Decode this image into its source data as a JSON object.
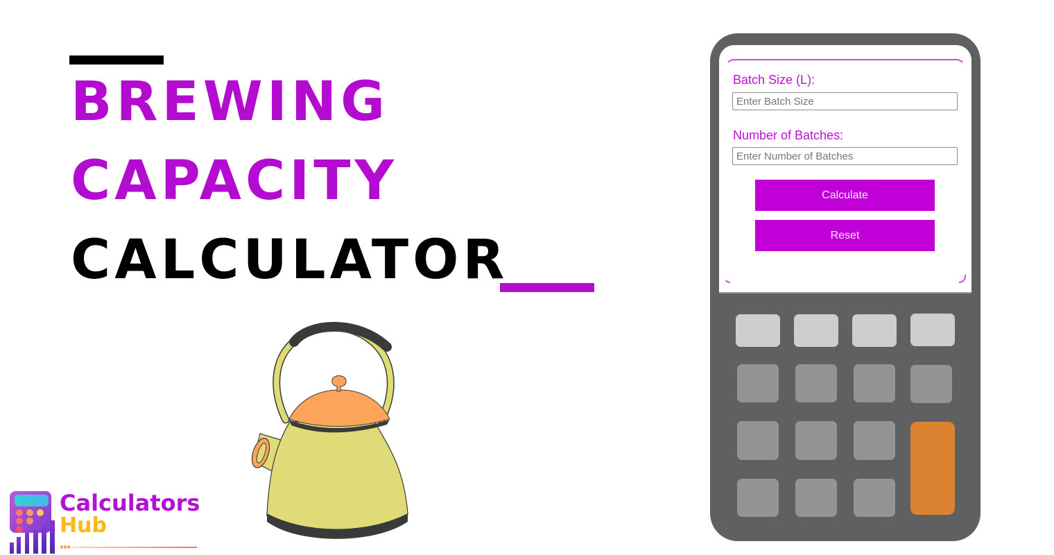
{
  "title": {
    "line1": "Brewing",
    "line2": "Capacity",
    "line3": "Calculator"
  },
  "brand": {
    "name_part1": "Calculators",
    "name_part2": "Hub",
    "primary_color": "#b30bd0",
    "secondary_color": "#fdb813"
  },
  "calculator_form": {
    "fields": [
      {
        "label": "Batch Size (L):",
        "placeholder": "Enter Batch Size",
        "value": ""
      },
      {
        "label": "Number of Batches:",
        "placeholder": "Enter Number of Batches",
        "value": ""
      }
    ],
    "calculate_label": "Calculate",
    "reset_label": "Reset",
    "accent_color": "#c000d6"
  },
  "keypad": {
    "colors": {
      "top_row": "#cfcecc",
      "keys": "#949494",
      "equals": "#db8330",
      "body": "#5f6062"
    }
  },
  "illustration": {
    "subject": "kettle-icon",
    "colors": {
      "body": "#dfdb76",
      "lid": "#fca55a",
      "handle": "#3a3a38"
    }
  }
}
